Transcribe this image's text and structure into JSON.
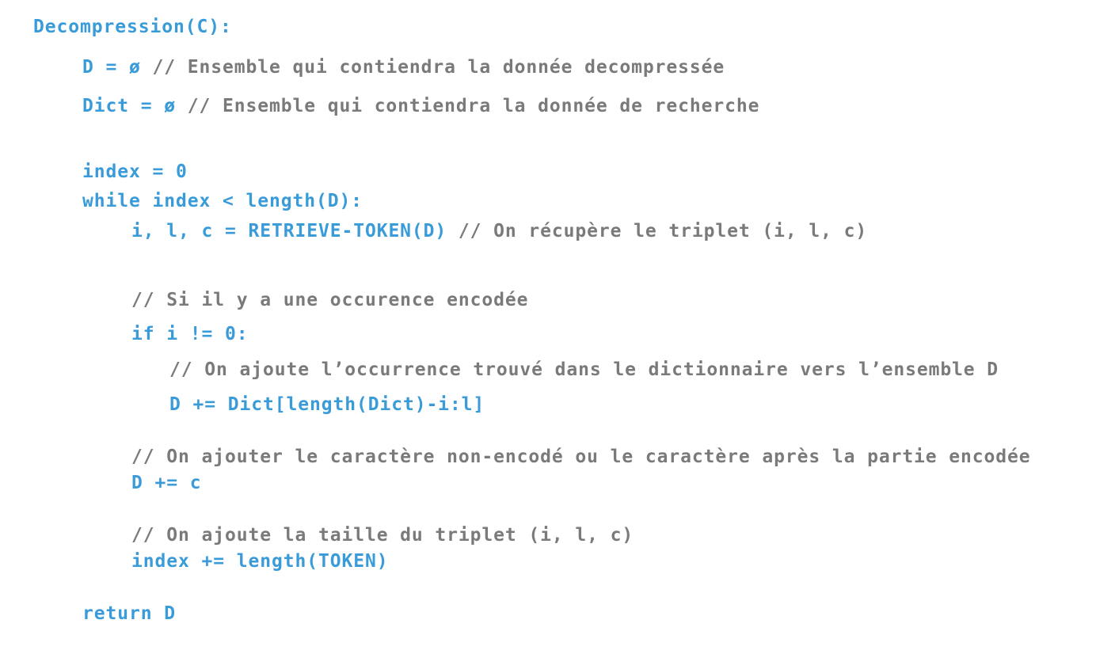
{
  "function_header": "Decompression(C):",
  "lines": {
    "d_init": {
      "code": "D = ø ",
      "comment": "// Ensemble qui contiendra la donnée decompressée"
    },
    "dict_init": {
      "code": "Dict = ø ",
      "comment": "// Ensemble qui contiendra la donnée de recherche"
    },
    "index_init": {
      "code": "index = 0"
    },
    "while_loop": {
      "code": "while index < length(D):"
    },
    "retrieve": {
      "code": "i, l, c = RETRIEVE-TOKEN(D) ",
      "comment": "// On récupère le triplet (i, l, c)"
    },
    "if_comment": {
      "comment": "// Si il y a une occurence encodée"
    },
    "if_stmt": {
      "code": "if i != 0:"
    },
    "ajoute_comment": {
      "comment": "// On ajoute l’occurrence trouvé dans le dictionnaire vers l’ensemble D"
    },
    "dict_slice": {
      "code": "D += Dict[length(Dict)-i:l]"
    },
    "caractere_comment": {
      "comment": "// On ajouter le caractère non-encodé ou le caractère après la partie encodée"
    },
    "add_c": {
      "code": "D += c"
    },
    "taille_comment": {
      "comment": "// On ajoute la taille du triplet (i, l, c)"
    },
    "index_inc": {
      "code": "index += length(TOKEN)"
    },
    "return_stmt": {
      "code": "return D"
    }
  },
  "colors": {
    "code": "#3A9BD9",
    "comment": "#7A7A7A",
    "background": "#FFFFFF"
  }
}
